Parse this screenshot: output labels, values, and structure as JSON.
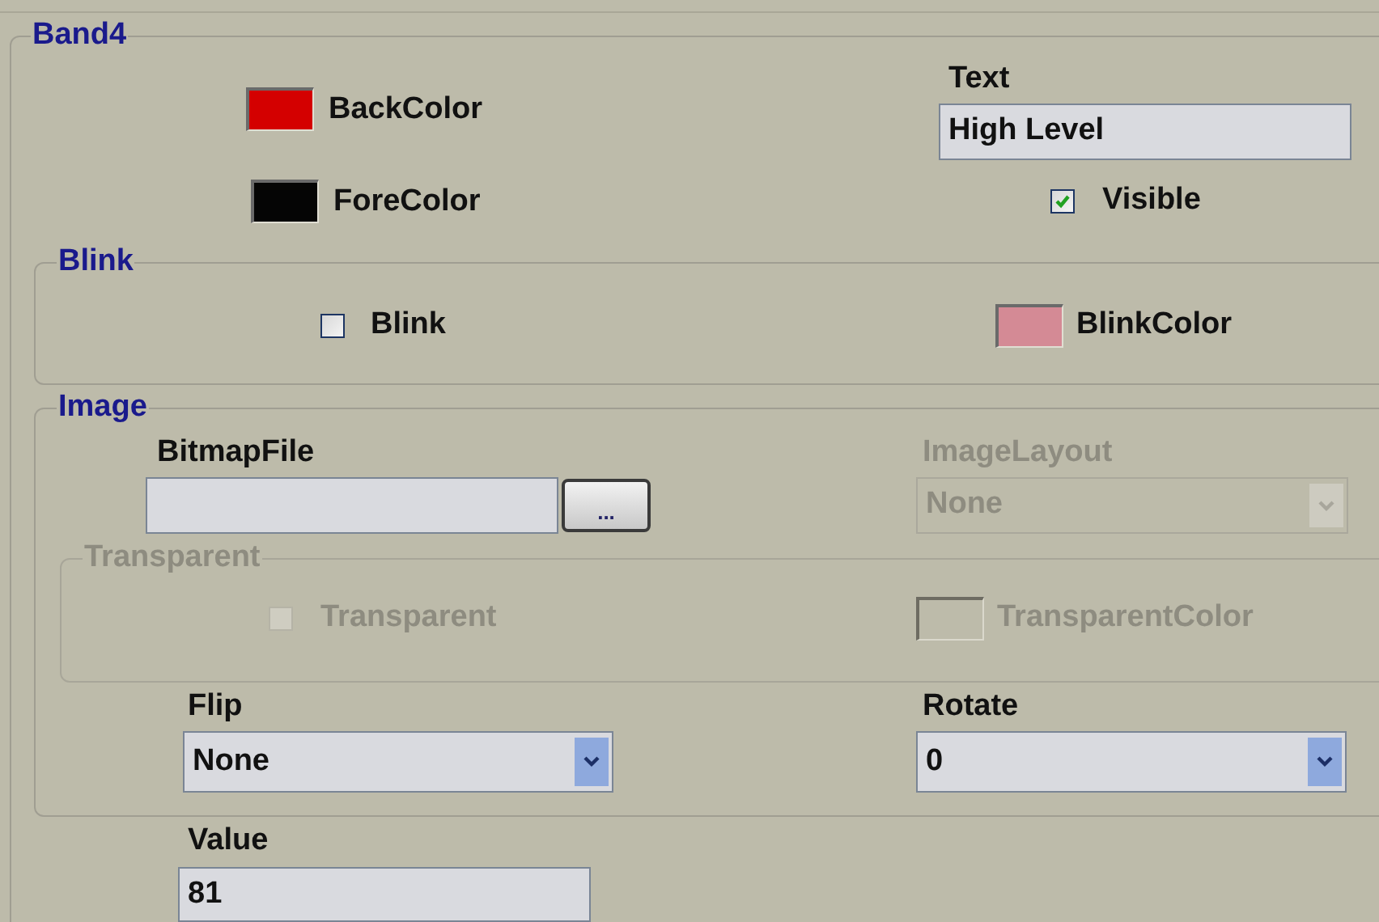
{
  "band": {
    "title": "Band4",
    "back_color": {
      "label": "BackColor",
      "color": "#d40000"
    },
    "fore_color": {
      "label": "ForeColor",
      "color": "#050505"
    },
    "text": {
      "label": "Text",
      "value": "High Level"
    },
    "visible": {
      "label": "Visible",
      "checked": true
    },
    "blink": {
      "title": "Blink",
      "blink": {
        "label": "Blink",
        "checked": false
      },
      "blink_color": {
        "label": "BlinkColor",
        "color": "#d48a95"
      }
    },
    "image": {
      "title": "Image",
      "bitmap_file": {
        "label": "BitmapFile",
        "browse": "..."
      },
      "image_layout": {
        "label": "ImageLayout",
        "value": "None",
        "disabled": true
      },
      "transparent": {
        "title": "Transparent",
        "disabled": true,
        "checkbox": {
          "label": "Transparent",
          "checked": false
        },
        "transparent_color": {
          "label": "TransparentColor"
        }
      },
      "flip": {
        "label": "Flip",
        "value": "None"
      },
      "rotate": {
        "label": "Rotate",
        "value": "0"
      }
    },
    "value": {
      "label": "Value",
      "value": "81"
    }
  }
}
